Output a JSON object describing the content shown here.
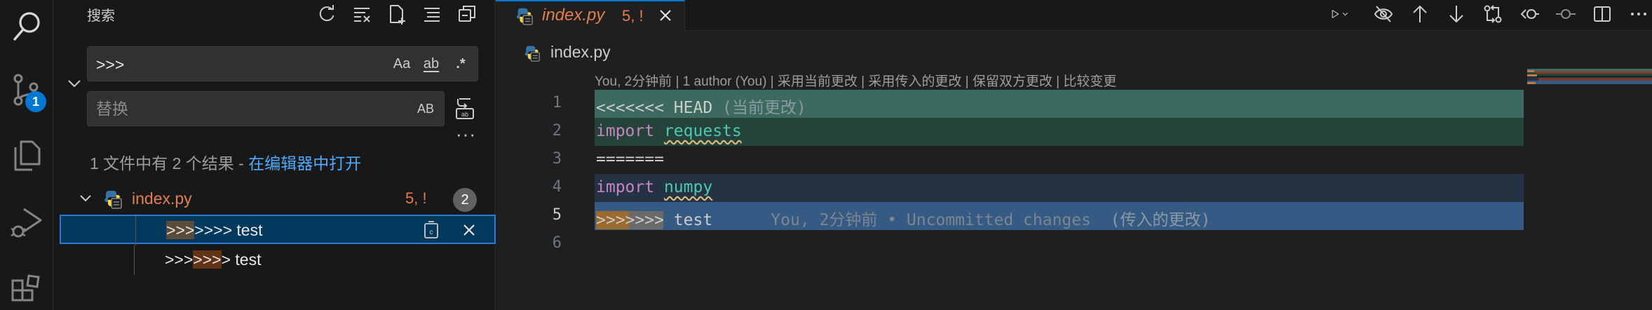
{
  "activity_bar": {
    "items": [
      {
        "name": "search",
        "icon": "search-icon"
      },
      {
        "name": "source-control",
        "icon": "source-control-icon",
        "badge": "1"
      },
      {
        "name": "explorer",
        "icon": "files-icon"
      },
      {
        "name": "run-debug",
        "icon": "debug-icon"
      },
      {
        "name": "extensions",
        "icon": "extensions-icon"
      }
    ]
  },
  "sidebar": {
    "title": "搜索",
    "actions": [
      "refresh-icon",
      "clear-results-icon",
      "new-search-editor-icon",
      "view-as-tree-icon",
      "collapse-all-icon"
    ],
    "search_value": ">>>",
    "search_options": {
      "match_case": "Aa",
      "whole_word": "ab",
      "regex": ".*"
    },
    "replace_placeholder": "替换",
    "preserve_case": "AB",
    "more": "···",
    "summary_text": "1 文件中有 2 个结果 - ",
    "summary_link": "在编辑器中打开",
    "file": {
      "name": "index.py",
      "status": "5, !",
      "match_count": "2"
    },
    "matches": [
      {
        "prefix": "",
        "highlight": ">>>",
        "suffix": ">>>> test",
        "selected": true
      },
      {
        "prefix": ">>>",
        "highlight": ">>>",
        "suffix": "> test",
        "selected": false
      }
    ]
  },
  "editor": {
    "tab": {
      "name": "index.py",
      "status": "5, !"
    },
    "breadcrumb": "index.py",
    "codelens": "You, 2分钟前 | 1 author (You) | 采用当前更改 | 采用传入的更改 | 保留双方更改 | 比较变更",
    "line_numbers": [
      "1",
      "2",
      "3",
      "4",
      "5",
      "6"
    ],
    "lines": {
      "l1_marker": "<<<<<<< HEAD",
      "l1_label": " (当前更改)",
      "l2_kw": "import",
      "l2_mod": "requests",
      "l3": "=======",
      "l4_kw": "import",
      "l4_mod": "numpy",
      "l5_marker": ">>>>>>> test",
      "l5_blame": "      You, 2分钟前 • Uncommitted changes",
      "l5_label": "  (传入的更改)"
    },
    "colors": {
      "current_header": "#3d6a5e",
      "current_body": "#25423b",
      "incoming_body": "#243244",
      "incoming_header": "#355a83"
    }
  }
}
